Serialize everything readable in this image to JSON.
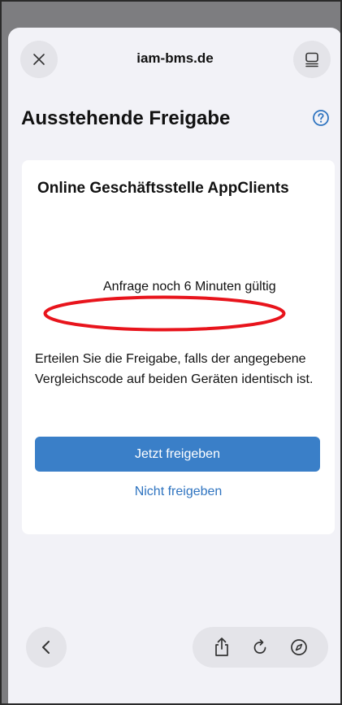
{
  "browser": {
    "url": "iam-bms.de",
    "close_icon": "close-icon",
    "reader_icon": "reader-icon"
  },
  "page": {
    "title": "Ausstehende Freigabe",
    "help_icon": "question-circle-icon"
  },
  "card": {
    "title": "Online Geschäftsstelle AppClients",
    "validity_text": "Anfrage noch 6 Minuten gültig",
    "info_text": "Erteilen Sie die Freigabe, falls der angegebene Vergleichscode auf beiden Geräten identisch ist.",
    "approve_label": "Jetzt freigeben",
    "deny_label": "Nicht freigeben"
  },
  "toolbar": {
    "back_icon": "chevron-left-icon",
    "share_icon": "share-icon",
    "reload_icon": "reload-icon",
    "safari_icon": "compass-icon"
  },
  "colors": {
    "primary_button": "#3a7fc8",
    "link": "#2f74c0",
    "annotation": "#e8141c",
    "sheet_background": "#f2f2f7"
  }
}
